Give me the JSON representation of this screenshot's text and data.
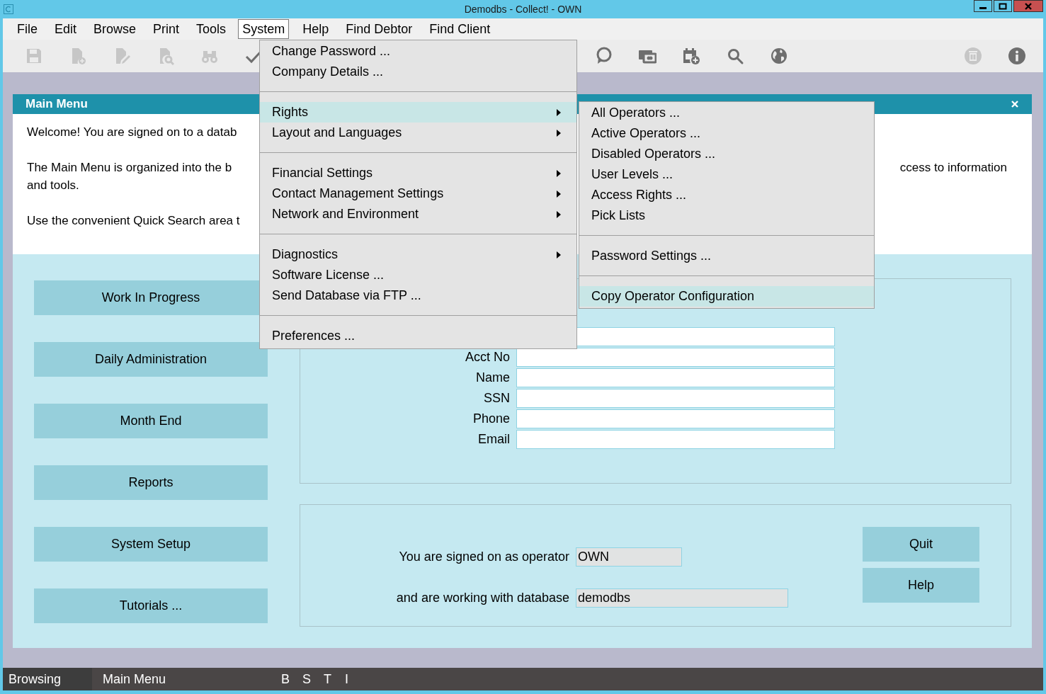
{
  "window": {
    "title": "Demodbs - Collect! - OWN"
  },
  "menubar": [
    {
      "label": "File",
      "selected": false
    },
    {
      "label": "Edit",
      "selected": false
    },
    {
      "label": "Browse",
      "selected": false
    },
    {
      "label": "Print",
      "selected": false
    },
    {
      "label": "Tools",
      "selected": false
    },
    {
      "label": "System",
      "selected": true
    },
    {
      "label": "Help",
      "selected": false
    },
    {
      "label": "Find Debtor",
      "selected": false
    },
    {
      "label": "Find Client",
      "selected": false
    }
  ],
  "toolbar": {
    "left": [
      {
        "kind": "save",
        "disabled": true
      },
      {
        "kind": "new-doc",
        "disabled": true
      },
      {
        "kind": "edit-doc",
        "disabled": true
      },
      {
        "kind": "find-doc",
        "disabled": true
      },
      {
        "kind": "binoculars",
        "disabled": true
      },
      {
        "kind": "check",
        "disabled": false
      }
    ],
    "middle": [
      {
        "kind": "chat",
        "disabled": false
      },
      {
        "kind": "card",
        "disabled": false
      },
      {
        "kind": "calendar",
        "disabled": false
      },
      {
        "kind": "search",
        "disabled": false
      },
      {
        "kind": "globe",
        "disabled": false
      }
    ],
    "right": [
      {
        "kind": "trash",
        "disabled": true
      },
      {
        "kind": "info",
        "disabled": false
      }
    ]
  },
  "main_menu": {
    "title": "Main Menu",
    "intro": [
      "Welcome! You are signed on to a datab",
      "The Main Menu is organized into the b",
      "and tools.",
      "Use the convenient Quick Search area t"
    ],
    "intro_right": "ccess to information",
    "nav_buttons": [
      "Work In Progress",
      "Daily Administration",
      "Month End",
      "Reports",
      "System Setup",
      "Tutorials ..."
    ],
    "quick_search": [
      {
        "kind": "blank"
      },
      {
        "kind": "labeled",
        "label": "Acct No"
      },
      {
        "kind": "labeled",
        "label": "Name"
      },
      {
        "kind": "labeled",
        "label": "SSN"
      },
      {
        "kind": "labeled",
        "label": "Phone"
      },
      {
        "kind": "labeled",
        "label": "Email"
      }
    ],
    "session": {
      "operator_label": "You are signed on as operator",
      "operator": "OWN",
      "database_label": "and are working with database",
      "database": "demodbs"
    },
    "buttons": [
      "Quit",
      "Help"
    ]
  },
  "system_menu": [
    [
      {
        "label": "Change Password ...",
        "submenu": false,
        "selected": false
      },
      {
        "label": "Company Details ...",
        "submenu": false,
        "selected": false
      }
    ],
    [
      {
        "label": "Rights",
        "submenu": true,
        "selected": true
      },
      {
        "label": "Layout and Languages",
        "submenu": true,
        "selected": false
      }
    ],
    [
      {
        "label": "Financial Settings",
        "submenu": true,
        "selected": false
      },
      {
        "label": "Contact Management Settings",
        "submenu": true,
        "selected": false
      },
      {
        "label": "Network and Environment",
        "submenu": true,
        "selected": false
      }
    ],
    [
      {
        "label": "Diagnostics",
        "submenu": true,
        "selected": false
      },
      {
        "label": "Software License ...",
        "submenu": false,
        "selected": false
      },
      {
        "label": "Send Database via FTP ...",
        "submenu": false,
        "selected": false
      }
    ],
    [
      {
        "label": "Preferences ...",
        "submenu": false,
        "selected": false
      }
    ]
  ],
  "rights_submenu": [
    [
      {
        "label": "All Operators ...",
        "selected": false
      },
      {
        "label": "Active Operators ...",
        "selected": false
      },
      {
        "label": "Disabled Operators ...",
        "selected": false
      },
      {
        "label": "User Levels ...",
        "selected": false
      },
      {
        "label": "Access Rights ...",
        "selected": false
      },
      {
        "label": "Pick Lists",
        "selected": false
      }
    ],
    [
      {
        "label": "Password Settings ...",
        "selected": false
      }
    ],
    [
      {
        "label": "Copy Operator Configuration",
        "selected": true
      }
    ]
  ],
  "status_bar": {
    "mode": "Browsing",
    "screen": "Main Menu",
    "flags": [
      "B",
      "S",
      "T",
      "I"
    ]
  }
}
